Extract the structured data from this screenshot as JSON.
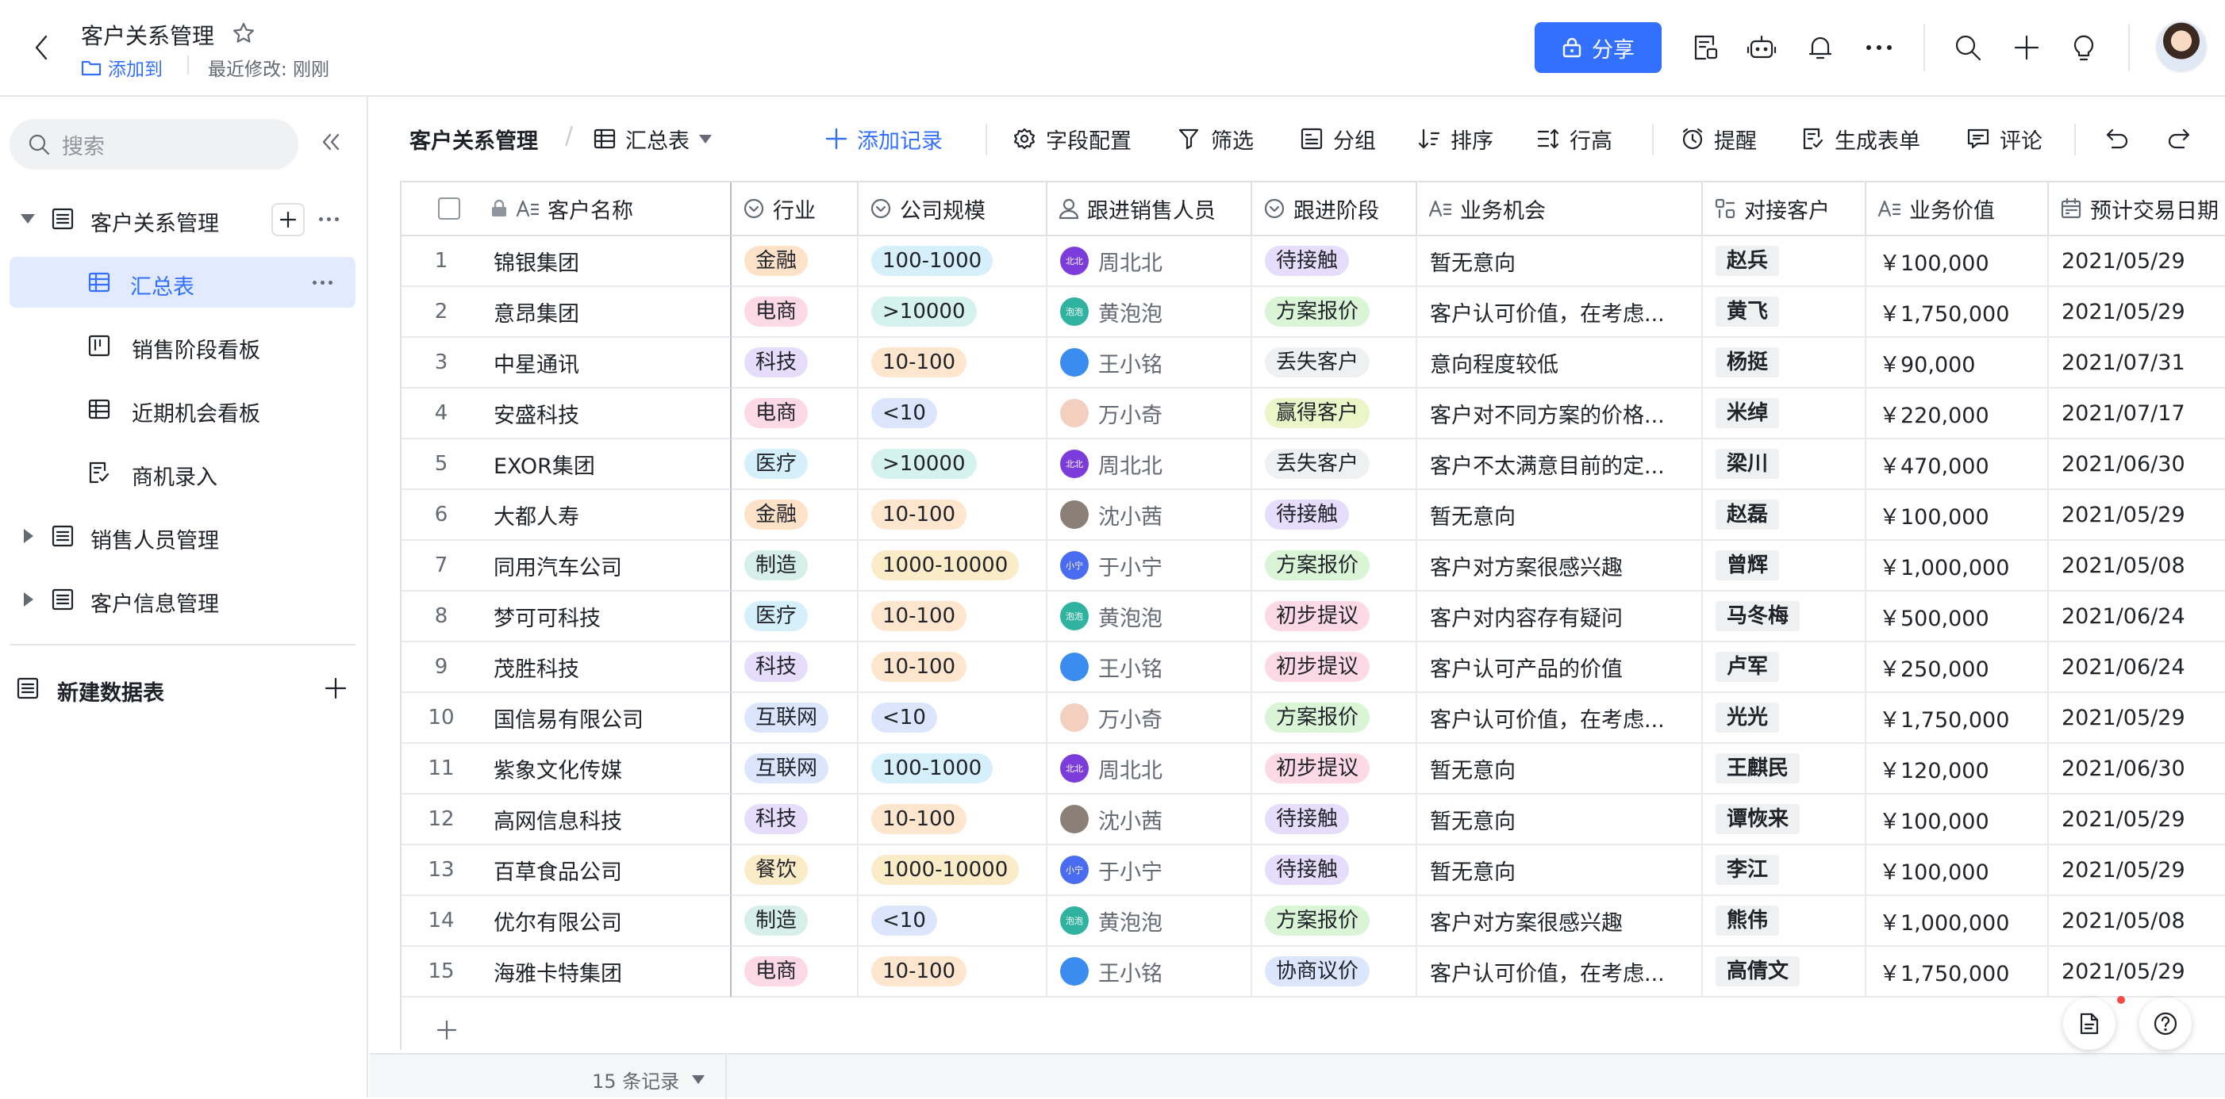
{
  "header": {
    "title": "客户关系管理",
    "add_to": "添加到",
    "last_modified": "最近修改: 刚刚",
    "share_label": "分享"
  },
  "sidebar": {
    "search_placeholder": "搜索",
    "items": [
      {
        "label": "客户关系管理",
        "icon": "table-doc-icon"
      },
      {
        "label": "汇总表",
        "icon": "grid-view-icon"
      },
      {
        "label": "销售阶段看板",
        "icon": "kanban-icon"
      },
      {
        "label": "近期机会看板",
        "icon": "grid-view-icon"
      },
      {
        "label": "商机录入",
        "icon": "form-icon"
      },
      {
        "label": "销售人员管理",
        "icon": "table-doc-icon"
      },
      {
        "label": "客户信息管理",
        "icon": "table-doc-icon"
      }
    ],
    "new_table": "新建数据表"
  },
  "viewbar": {
    "crumb_table": "客户关系管理",
    "crumb_view": "汇总表",
    "add_record": "添加记录",
    "field_config": "字段配置",
    "filter": "筛选",
    "group": "分组",
    "sort": "排序",
    "row_height": "行高",
    "remind": "提醒",
    "gen_form": "生成表单",
    "comment": "评论"
  },
  "table": {
    "columns": [
      "客户名称",
      "行业",
      "公司规模",
      "跟进销售人员",
      "跟进阶段",
      "业务机会",
      "对接客户",
      "业务价值",
      "预计交易日期"
    ],
    "rows": [
      {
        "n": "1",
        "name": "锦银集团",
        "industry": "金融",
        "size": "100-1000",
        "sales": "周北北",
        "stage": "待接触",
        "opp": "暂无意向",
        "contact": "赵兵",
        "value": "￥100,000",
        "date": "2021/05/29"
      },
      {
        "n": "2",
        "name": "意昂集团",
        "industry": "电商",
        "size": ">10000",
        "sales": "黄泡泡",
        "stage": "方案报价",
        "opp": "客户认可价值，在考虑...",
        "contact": "黄飞",
        "value": "￥1,750,000",
        "date": "2021/05/29"
      },
      {
        "n": "3",
        "name": "中星通讯",
        "industry": "科技",
        "size": "10-100",
        "sales": "王小铭",
        "stage": "丢失客户",
        "opp": "意向程度较低",
        "contact": "杨挺",
        "value": "￥90,000",
        "date": "2021/07/31"
      },
      {
        "n": "4",
        "name": "安盛科技",
        "industry": "电商",
        "size": "<10",
        "sales": "万小奇",
        "stage": "赢得客户",
        "opp": "客户对不同方案的价格...",
        "contact": "米绰",
        "value": "￥220,000",
        "date": "2021/07/17"
      },
      {
        "n": "5",
        "name": "EXOR集团",
        "industry": "医疗",
        "size": ">10000",
        "sales": "周北北",
        "stage": "丢失客户",
        "opp": "客户不太满意目前的定...",
        "contact": "梁川",
        "value": "￥470,000",
        "date": "2021/06/30"
      },
      {
        "n": "6",
        "name": "大都人寿",
        "industry": "金融",
        "size": "10-100",
        "sales": "沈小茜",
        "stage": "待接触",
        "opp": "暂无意向",
        "contact": "赵磊",
        "value": "￥100,000",
        "date": "2021/05/29"
      },
      {
        "n": "7",
        "name": "同用汽车公司",
        "industry": "制造",
        "size": "1000-10000",
        "sales": "于小宁",
        "stage": "方案报价",
        "opp": "客户对方案很感兴趣",
        "contact": "曾辉",
        "value": "￥1,000,000",
        "date": "2021/05/08"
      },
      {
        "n": "8",
        "name": "梦可可科技",
        "industry": "医疗",
        "size": "10-100",
        "sales": "黄泡泡",
        "stage": "初步提议",
        "opp": "客户对内容存有疑问",
        "contact": "马冬梅",
        "value": "￥500,000",
        "date": "2021/06/24"
      },
      {
        "n": "9",
        "name": "茂胜科技",
        "industry": "科技",
        "size": "10-100",
        "sales": "王小铭",
        "stage": "初步提议",
        "opp": "客户认可产品的价值",
        "contact": "卢军",
        "value": "￥250,000",
        "date": "2021/06/24"
      },
      {
        "n": "10",
        "name": "国信易有限公司",
        "industry": "互联网",
        "size": "<10",
        "sales": "万小奇",
        "stage": "方案报价",
        "opp": "客户认可价值，在考虑...",
        "contact": "光光",
        "value": "￥1,750,000",
        "date": "2021/05/29"
      },
      {
        "n": "11",
        "name": "紫象文化传媒",
        "industry": "互联网",
        "size": "100-1000",
        "sales": "周北北",
        "stage": "初步提议",
        "opp": "暂无意向",
        "contact": "王麒民",
        "value": "￥120,000",
        "date": "2021/06/30"
      },
      {
        "n": "12",
        "name": "高网信息科技",
        "industry": "科技",
        "size": "10-100",
        "sales": "沈小茜",
        "stage": "待接触",
        "opp": "暂无意向",
        "contact": "谭恢来",
        "value": "￥100,000",
        "date": "2021/05/29"
      },
      {
        "n": "13",
        "name": "百草食品公司",
        "industry": "餐饮",
        "size": "1000-10000",
        "sales": "于小宁",
        "stage": "待接触",
        "opp": "暂无意向",
        "contact": "李江",
        "value": "￥100,000",
        "date": "2021/05/29"
      },
      {
        "n": "14",
        "name": "优尔有限公司",
        "industry": "制造",
        "size": "<10",
        "sales": "黄泡泡",
        "stage": "方案报价",
        "opp": "客户对方案很感兴趣",
        "contact": "熊伟",
        "value": "￥1,000,000",
        "date": "2021/05/08"
      },
      {
        "n": "15",
        "name": "海雅卡特集团",
        "industry": "电商",
        "size": "10-100",
        "sales": "王小铭",
        "stage": "协商议价",
        "opp": "客户认可价值，在考虑...",
        "contact": "高倩文",
        "value": "￥1,750,000",
        "date": "2021/05/29"
      }
    ],
    "avatar_text": {
      "周北北": "北北",
      "黄泡泡": "泡泡",
      "于小宁": "小宁"
    }
  },
  "colors": {
    "accent": "#3370ff",
    "industry": {
      "金融": "#fde2c8",
      "电商": "#fcd9e4",
      "科技": "#e6dcfb",
      "医疗": "#d6f0fb",
      "制造": "#d6efe8",
      "互联网": "#dbe6fd",
      "餐饮": "#fbecc8"
    },
    "size": {
      "100-1000": "#d6f0fb",
      ">10000": "#d5f2ee",
      "10-100": "#fde6cd",
      "<10": "#dbe6fd",
      "1000-10000": "#fbecc8"
    },
    "stage": {
      "待接触": "#e6dcfb",
      "方案报价": "#d9f5d6",
      "丢失客户": "#eff0f1",
      "赢得客户": "#ecf5c8",
      "初步提议": "#fcd9e4",
      "协商议价": "#dbe6fd"
    },
    "sales": {
      "周北北": "#7b3cdb",
      "黄泡泡": "#2fb3a0",
      "王小铭": "#3b8cf0",
      "万小奇": "#f3cfc0",
      "沈小茜": "#8a8078",
      "于小宁": "#4a6cf0"
    }
  },
  "footer": {
    "record_count": "15 条记录"
  }
}
